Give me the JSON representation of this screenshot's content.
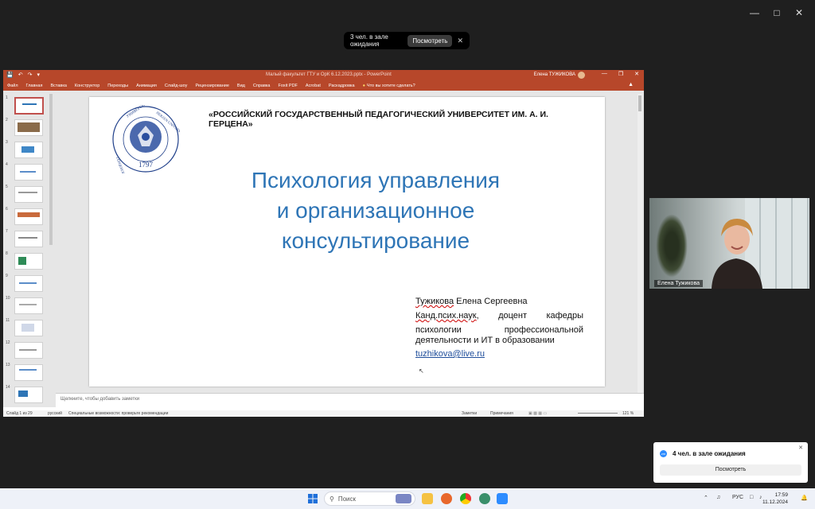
{
  "zoom": {
    "waiting_banner": {
      "text": "3 чел. в зале ожидания",
      "button": "Посмотреть"
    },
    "notification": {
      "title": "4 чел. в зале ожидания",
      "button": "Посмотреть"
    },
    "video": {
      "participant_name": "Елена Тужикова"
    }
  },
  "powerpoint": {
    "title": "Малый факультет ГТУ и ОрК 6.12.2023.pptx  -  PowerPoint",
    "user": "Елена ТУЖИКОВА",
    "tabs": [
      "Файл",
      "Главная",
      "Вставка",
      "Конструктор",
      "Переходы",
      "Анимация",
      "Слайд-шоу",
      "Рецензирование",
      "Вид",
      "Справка",
      "Foxit PDF",
      "Acrobat",
      "Раскадровка"
    ],
    "tell_me": "Что вы хотите сделать?",
    "slide_numbers": [
      "1",
      "2",
      "3",
      "4",
      "5",
      "6",
      "7",
      "8",
      "9",
      "10",
      "11",
      "12",
      "13",
      "14"
    ],
    "notes_placeholder": "Щелкните, чтобы добавить заметки",
    "status": {
      "slide": "Слайд 1 из 29",
      "language": "русский",
      "accessibility": "Специальные возможности: проверьте рекомендации",
      "notes": "Заметки",
      "comments": "Примечания",
      "zoom": "121 %"
    },
    "slide": {
      "university": "«РОССИЙСКИЙ ГОСУДАРСТВЕННЫЙ  ПЕДАГОГИЧЕСКИЙ УНИВЕРСИТЕТ ИМ. А. И. ГЕРЦЕНА»",
      "title_line1": "Психология управления",
      "title_line2": "и организационное",
      "title_line3": "консультирование",
      "author_surname": "Тужикова",
      "author_rest": " Елена Сергеевна",
      "degree_word": "Канд.псих.наук",
      "degree_line1_rest": ", доцент кафедры",
      "degree_line2": "психологии профессиональной",
      "degree_line3": "деятельности и ИТ в образовании",
      "email": "tuzhikova@live.ru",
      "seal_year": "1797",
      "seal_text_left": "УНИВЕРСИТЕТ",
      "seal_text_right": "HERZEN UNIVERSITY",
      "seal_text_bottom": "ГЕРЦЕНОВСКИЙ"
    }
  },
  "taskbar": {
    "search_placeholder": "Поиск",
    "language": "РУС",
    "time": "17:59",
    "date": "11.12.2024"
  },
  "colors": {
    "ppt_accent": "#b7472a",
    "slide_title": "#2e75b6",
    "zoom_blue": "#2d8cff"
  }
}
